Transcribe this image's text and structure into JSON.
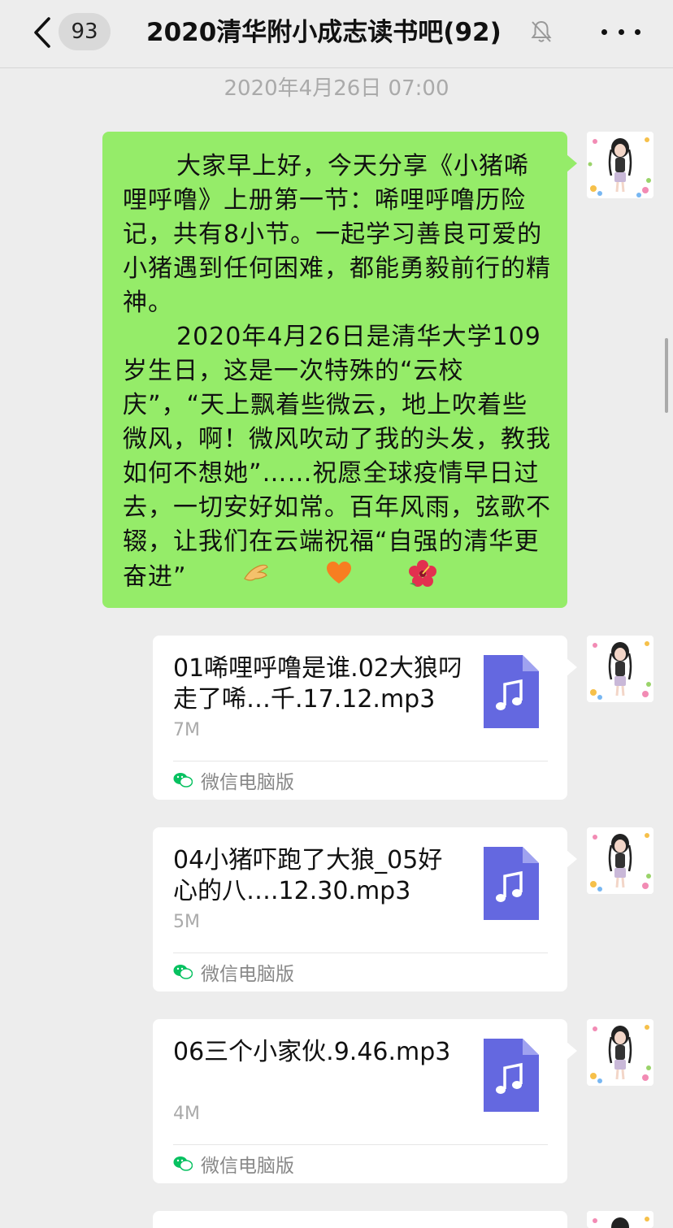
{
  "header": {
    "back_icon": "chevron-left-icon",
    "unread_count": "93",
    "chat_title": "2020清华附小成志读书吧(92)",
    "mute_icon": "bell-muted-icon",
    "more_icon": "ellipsis-icon"
  },
  "timestamp": "2020年4月26日 07:00",
  "message": {
    "paragraph_1": "大家早上好，今天分享《小猪唏哩呼噜》上册第一节：唏哩呼噜历险记，共有8小节。一起学习善良可爱的小猪遇到任何困难，都能勇毅前行的精神。",
    "paragraph_2": "2020年4月26日是清华大学109岁生日，这是一次特殊的“云校庆”，“天上飘着些微云，地上吹着些微风，啊！微风吹动了我的头发，教我如何不想她”……祝愿全球疫情早日过去，一切安好如常。百年风雨，弦歌不辍，让我们在云端祝福“自强的清华更奋进”",
    "emojis": [
      "pinching-hand-emoji",
      "orange-heart-emoji",
      "hibiscus-emoji"
    ],
    "bubble_color": "#95ec69"
  },
  "files": [
    {
      "name": "01唏哩呼噜是谁.02大狼叼走了唏…千.17.12.mp3",
      "size": "7M",
      "source": "微信电脑版",
      "icon": "music-file-icon"
    },
    {
      "name": "04小猪吓跑了大狼_05好心的八….12.30.mp3",
      "size": "5M",
      "source": "微信电脑版",
      "icon": "music-file-icon"
    },
    {
      "name": "06三个小家伙.9.46.mp3",
      "size": "4M",
      "source": "微信电脑版",
      "icon": "music-file-icon"
    }
  ],
  "colors": {
    "background": "#ededed",
    "file_icon": "#6468e0",
    "wechat_green": "#07c160"
  }
}
